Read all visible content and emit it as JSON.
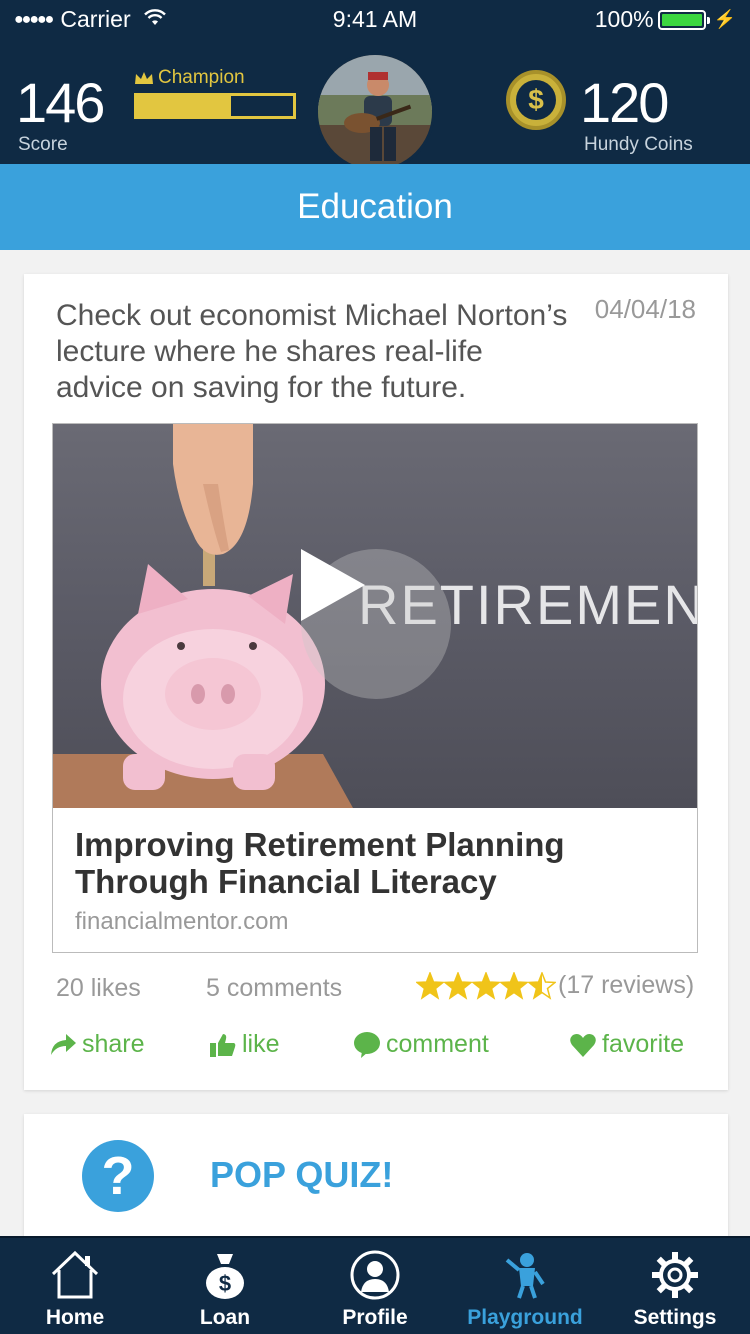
{
  "status_bar": {
    "signal": "●●●●●",
    "carrier": "Carrier",
    "time": "9:41 AM",
    "battery": "100%"
  },
  "header": {
    "score": "146",
    "score_label": "Score",
    "rank": "Champion",
    "rank_progress": 0.6,
    "coins": "120",
    "coins_label": "Hundy Coins",
    "coin_symbol": "$"
  },
  "section": {
    "title": "Education"
  },
  "card": {
    "text": "Check out economist Michael Norton’s lecture where he shares real-life advice on saving for the future.",
    "date": "04/04/18",
    "thumbnail_word": "RETIREMENT",
    "link_title": "Improving Retirement Planning Through Financial Literacy",
    "link_domain": "financialmentor.com",
    "likes": "20 likes",
    "comments": "5 comments",
    "rating": 4.5,
    "reviews": "(17 reviews)",
    "actions": {
      "share": "share",
      "like": "like",
      "comment": "comment",
      "favorite": "favorite"
    }
  },
  "quiz": {
    "icon_text": "?",
    "title": "POP QUIZ!"
  },
  "tabbar": {
    "items": [
      {
        "label": "Home",
        "icon": "home-icon"
      },
      {
        "label": "Loan",
        "icon": "money-bag-icon"
      },
      {
        "label": "Profile",
        "icon": "profile-icon"
      },
      {
        "label": "Playground",
        "icon": "playground-icon"
      },
      {
        "label": "Settings",
        "icon": "gear-icon"
      }
    ],
    "active": "Playground"
  },
  "colors": {
    "header_bg": "#0f2a44",
    "accent_blue": "#3aa1dc",
    "gold": "#e2c640",
    "action_green": "#5cb44a",
    "star_gold": "#f0c419"
  }
}
